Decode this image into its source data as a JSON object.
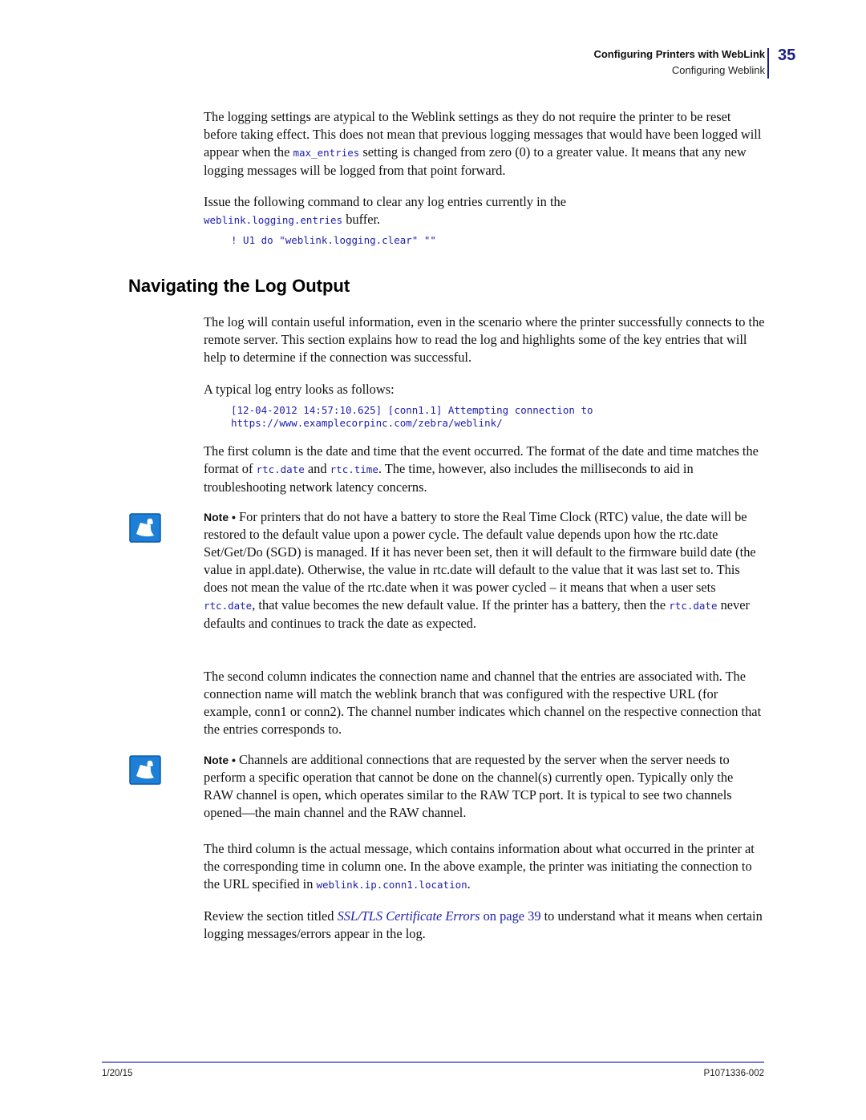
{
  "header": {
    "chapter_title": "Configuring Printers with WebLink",
    "section_title": "Configuring Weblink",
    "page_number": "35"
  },
  "intro": {
    "p1_a": "The logging settings are atypical to the Weblink settings as they do not require the printer to be reset before taking effect. This does not mean that previous logging messages that would have been logged will appear when the ",
    "p1_code": "max_entries",
    "p1_b": " setting is changed from zero (0) to a greater value. It means that any new logging messages will be logged from that point forward.",
    "p2_a": "Issue the following command to clear any log entries currently in the ",
    "p2_code": "weblink.logging.entries",
    "p2_b": " buffer.",
    "command": "! U1 do \"weblink.logging.clear\" \"\""
  },
  "section": {
    "heading": "Navigating the Log Output",
    "p1": "The log will contain useful information, even in the scenario where the printer successfully connects to the remote server. This section explains how to read the log and highlights some of the key entries that will help to determine if the connection was successful.",
    "p2": "A typical log entry looks as follows:",
    "log_line1": "[12-04-2012 14:57:10.625] [conn1.1] Attempting connection to",
    "log_line2": "https://www.examplecorpinc.com/zebra/weblink/",
    "p3_a": "The first column is the date and time that the event occurred. The format of the date and time matches the format of ",
    "p3_code1": "rtc.date",
    "p3_mid": " and ",
    "p3_code2": "rtc.time",
    "p3_b": ". The time, however, also includes the milliseconds to aid in troubleshooting network latency concerns.",
    "note1_label": "Note •",
    "note1_a": " For printers that do not have a battery to store the Real Time Clock (RTC) value, the date will be restored to the default value upon a power cycle. The default value depends upon how the rtc.date Set/Get/Do (SGD) is managed. If it has never been set, then it will default to the firmware build date (the value in appl.date). Otherwise, the value in rtc.date will default to the value that it was last set to. This does not mean the value of the rtc.date when it was power cycled – it means that when a user sets ",
    "note1_code1": "rtc.date",
    "note1_b": ", that value becomes the new default value. If the printer has a battery, then the ",
    "note1_code2": "rtc.date",
    "note1_c": " never defaults and continues to track the date as expected.",
    "p4": "The second column indicates the connection name and channel that the entries are associated with. The connection name will match the weblink branch that was configured with the respective URL (for example, conn1 or conn2). The channel number indicates which channel on the respective connection that the entries corresponds to.",
    "note2_label": "Note •",
    "note2_text": " Channels are additional connections that are requested by the server when the server needs to perform a specific operation that cannot be done on the channel(s) currently open. Typically only the RAW channel is open, which operates similar to the RAW TCP port. It is typical to see two channels opened—the main channel and the RAW channel.",
    "p5_a": "The third column is the actual message, which contains information about what occurred in the printer at the corresponding time in column one. In the above example, the printer was initiating the connection to the URL specified in ",
    "p5_code": "weblink.ip.conn1.location",
    "p5_b": ".",
    "p6_a": "Review the section titled ",
    "p6_link_title": "SSL/TLS Certificate Errors",
    "p6_link_page": " on page 39",
    "p6_b": " to understand what it means when certain logging messages/errors appear in the log."
  },
  "footer": {
    "date": "1/20/15",
    "doc_number": "P1071336-002"
  },
  "colors": {
    "accent": "#1a1a8c",
    "code": "#1d1db0",
    "note_icon": "#1e7fd6"
  }
}
